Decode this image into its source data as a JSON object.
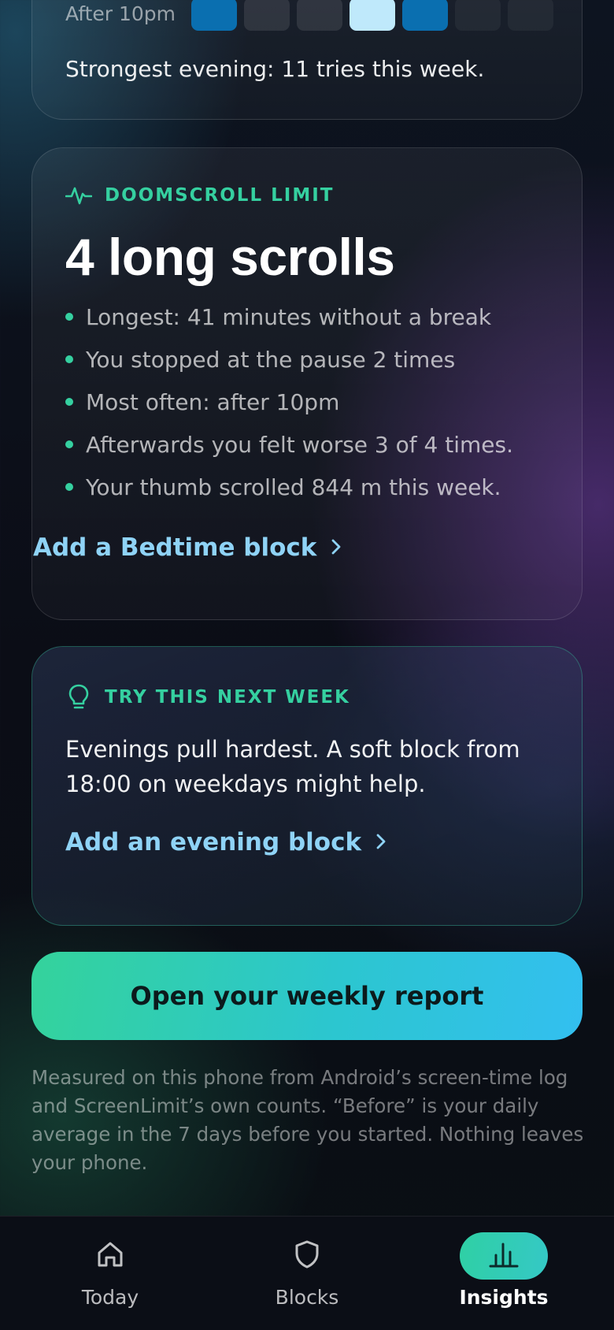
{
  "evening_section": {
    "row_label": "After 10pm",
    "cells": [
      "l1",
      "l0",
      "l0",
      "l3",
      "l1",
      "z",
      "z"
    ],
    "note": "Strongest evening: 11 tries this week."
  },
  "doomscroll": {
    "eyebrow": "DOOMSCROLL LIMIT",
    "title": "4 long scrolls",
    "bullets": [
      "Longest: 41 minutes without a break",
      "You stopped at the pause 2 times",
      "Most often: after 10pm",
      "Afterwards you felt worse 3 of 4 times.",
      "Your thumb scrolled 844 m this week."
    ],
    "link": "Add a Bedtime block"
  },
  "try_next": {
    "eyebrow": "TRY THIS NEXT WEEK",
    "text": "Evenings pull hardest. A soft block from 18:00 on weekdays might help.",
    "link": "Add an evening block"
  },
  "report_button": "Open your weekly report",
  "footnote": "Measured on this phone from Android’s screen-time log and ScreenLimit’s own counts. “Before” is your daily average in the 7 days before you started. Nothing leaves your phone.",
  "tabs": [
    {
      "label": "Today",
      "icon": "home-icon",
      "active": false
    },
    {
      "label": "Blocks",
      "icon": "shield-icon",
      "active": false
    },
    {
      "label": "Insights",
      "icon": "bar-chart-icon",
      "active": true
    }
  ],
  "colors": {
    "accent_green": "#35d0a0",
    "link_blue": "#8fd3f6",
    "cell_blue": "#0a6fb0",
    "cell_light": "#bfe9fb"
  }
}
